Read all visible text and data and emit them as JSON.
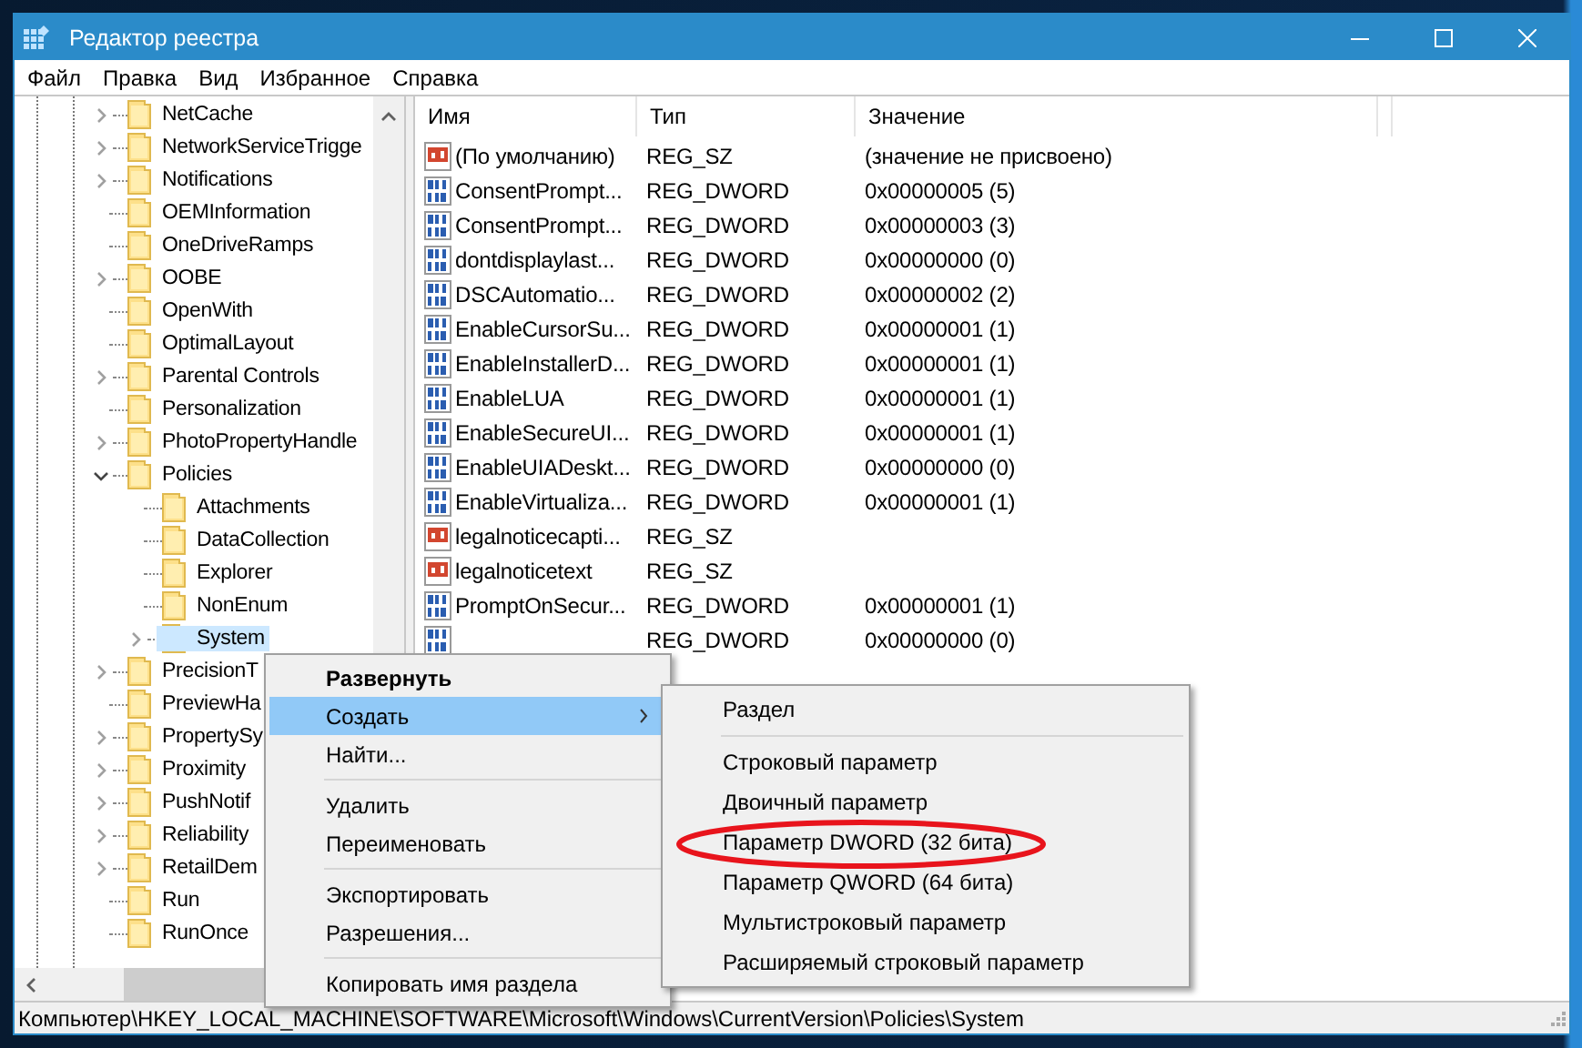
{
  "window": {
    "title": "Редактор реестра"
  },
  "menu": [
    {
      "label": "Файл"
    },
    {
      "label": "Правка"
    },
    {
      "label": "Вид"
    },
    {
      "label": "Избранное"
    },
    {
      "label": "Справка"
    }
  ],
  "tree": {
    "items": [
      {
        "label": "NetCache",
        "expandable": true,
        "expanded": false,
        "selected": false
      },
      {
        "label": "NetworkServiceTrigge",
        "expandable": true,
        "expanded": false,
        "selected": false
      },
      {
        "label": "Notifications",
        "expandable": true,
        "expanded": false,
        "selected": false
      },
      {
        "label": "OEMInformation",
        "expandable": false,
        "expanded": false,
        "selected": false
      },
      {
        "label": "OneDriveRamps",
        "expandable": false,
        "expanded": false,
        "selected": false
      },
      {
        "label": "OOBE",
        "expandable": true,
        "expanded": false,
        "selected": false
      },
      {
        "label": "OpenWith",
        "expandable": false,
        "expanded": false,
        "selected": false
      },
      {
        "label": "OptimalLayout",
        "expandable": false,
        "expanded": false,
        "selected": false
      },
      {
        "label": "Parental Controls",
        "expandable": true,
        "expanded": false,
        "selected": false
      },
      {
        "label": "Personalization",
        "expandable": false,
        "expanded": false,
        "selected": false
      },
      {
        "label": "PhotoPropertyHandle",
        "expandable": true,
        "expanded": false,
        "selected": false
      },
      {
        "label": "Policies",
        "expandable": true,
        "expanded": true,
        "selected": false,
        "children": [
          {
            "label": "Attachments",
            "expandable": false,
            "expanded": false,
            "selected": false
          },
          {
            "label": "DataCollection",
            "expandable": false,
            "expanded": false,
            "selected": false
          },
          {
            "label": "Explorer",
            "expandable": false,
            "expanded": false,
            "selected": false
          },
          {
            "label": "NonEnum",
            "expandable": false,
            "expanded": false,
            "selected": false
          },
          {
            "label": "System",
            "expandable": true,
            "expanded": false,
            "selected": true
          }
        ]
      },
      {
        "label": "PrecisionT",
        "expandable": true,
        "expanded": false,
        "selected": false
      },
      {
        "label": "PreviewHa",
        "expandable": false,
        "expanded": false,
        "selected": false
      },
      {
        "label": "PropertySy",
        "expandable": true,
        "expanded": false,
        "selected": false
      },
      {
        "label": "Proximity",
        "expandable": true,
        "expanded": false,
        "selected": false
      },
      {
        "label": "PushNotif",
        "expandable": true,
        "expanded": false,
        "selected": false
      },
      {
        "label": "Reliability",
        "expandable": true,
        "expanded": false,
        "selected": false
      },
      {
        "label": "RetailDem",
        "expandable": true,
        "expanded": false,
        "selected": false
      },
      {
        "label": "Run",
        "expandable": false,
        "expanded": false,
        "selected": false
      },
      {
        "label": "RunOnce",
        "expandable": false,
        "expanded": false,
        "selected": false
      }
    ]
  },
  "list": {
    "columns": [
      {
        "label": "Имя"
      },
      {
        "label": "Тип"
      },
      {
        "label": "Значение"
      }
    ],
    "rows": [
      {
        "kind": "string",
        "name": "(По умолчанию)",
        "type": "REG_SZ",
        "value": "(значение не присвоено)"
      },
      {
        "kind": "binary",
        "name": "ConsentPrompt...",
        "type": "REG_DWORD",
        "value": "0x00000005 (5)"
      },
      {
        "kind": "binary",
        "name": "ConsentPrompt...",
        "type": "REG_DWORD",
        "value": "0x00000003 (3)"
      },
      {
        "kind": "binary",
        "name": "dontdisplaylast...",
        "type": "REG_DWORD",
        "value": "0x00000000 (0)"
      },
      {
        "kind": "binary",
        "name": "DSCAutomatio...",
        "type": "REG_DWORD",
        "value": "0x00000002 (2)"
      },
      {
        "kind": "binary",
        "name": "EnableCursorSu...",
        "type": "REG_DWORD",
        "value": "0x00000001 (1)"
      },
      {
        "kind": "binary",
        "name": "EnableInstallerD...",
        "type": "REG_DWORD",
        "value": "0x00000001 (1)"
      },
      {
        "kind": "binary",
        "name": "EnableLUA",
        "type": "REG_DWORD",
        "value": "0x00000001 (1)"
      },
      {
        "kind": "binary",
        "name": "EnableSecureUI...",
        "type": "REG_DWORD",
        "value": "0x00000001 (1)"
      },
      {
        "kind": "binary",
        "name": "EnableUIADeskt...",
        "type": "REG_DWORD",
        "value": "0x00000000 (0)"
      },
      {
        "kind": "binary",
        "name": "EnableVirtualiza...",
        "type": "REG_DWORD",
        "value": "0x00000001 (1)"
      },
      {
        "kind": "string",
        "name": "legalnoticecapti...",
        "type": "REG_SZ"
      },
      {
        "kind": "string",
        "name": "legalnoticetext",
        "type": "REG_SZ"
      },
      {
        "kind": "binary",
        "name": "PromptOnSecur...",
        "type": "REG_DWORD",
        "value": "0x00000001 (1)"
      },
      {
        "kind": "binary",
        "type": "REG_DWORD",
        "value": "0x00000000 (0)"
      }
    ]
  },
  "context_menu": {
    "items": [
      {
        "kind": "item",
        "label": "Развернуть",
        "bold": true,
        "selected": false,
        "submenu": false
      },
      {
        "kind": "item",
        "label": "Создать",
        "bold": false,
        "selected": true,
        "submenu": true
      },
      {
        "kind": "item",
        "label": "Найти...",
        "bold": false,
        "selected": false,
        "submenu": false
      },
      {
        "kind": "separator"
      },
      {
        "kind": "item",
        "label": "Удалить",
        "bold": false,
        "selected": false,
        "submenu": false
      },
      {
        "kind": "item",
        "label": "Переименовать",
        "bold": false,
        "selected": false,
        "submenu": false
      },
      {
        "kind": "separator"
      },
      {
        "kind": "item",
        "label": "Экспортировать",
        "bold": false,
        "selected": false,
        "submenu": false
      },
      {
        "kind": "item",
        "label": "Разрешения...",
        "bold": false,
        "selected": false,
        "submenu": false
      },
      {
        "kind": "separator"
      },
      {
        "kind": "item",
        "label": "Копировать имя раздела",
        "bold": false,
        "selected": false,
        "submenu": false
      }
    ]
  },
  "submenu": {
    "items": [
      {
        "kind": "item",
        "label": "Раздел"
      },
      {
        "kind": "separator"
      },
      {
        "kind": "item",
        "label": "Строковый параметр"
      },
      {
        "kind": "item",
        "label": "Двоичный параметр"
      },
      {
        "kind": "item",
        "label": "Параметр DWORD (32 бита)"
      },
      {
        "kind": "item",
        "label": "Параметр QWORD (64 бита)"
      },
      {
        "kind": "item",
        "label": "Мультистроковый параметр"
      },
      {
        "kind": "item",
        "label": "Расширяемый строковый параметр"
      }
    ]
  },
  "annotation": {
    "kind": "ellipse"
  },
  "status_bar": "Компьютер\\HKEY_LOCAL_MACHINE\\SOFTWARE\\Microsoft\\Windows\\CurrentVersion\\Policies\\System"
}
